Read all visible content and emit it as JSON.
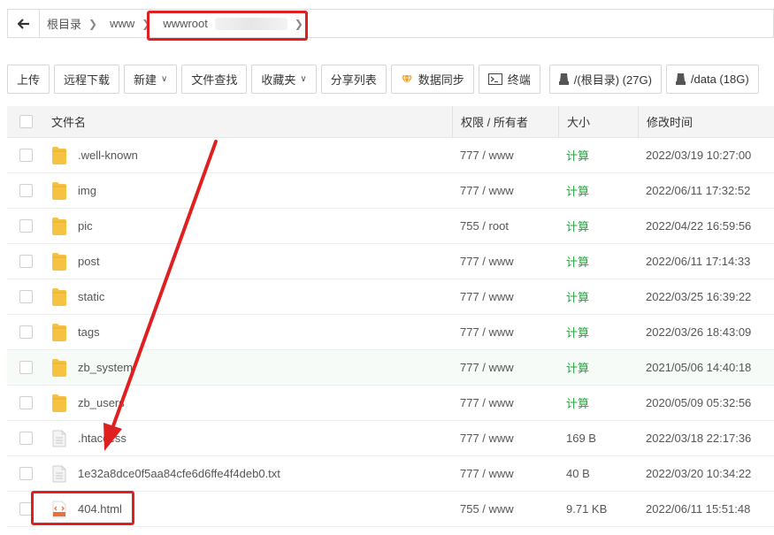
{
  "breadcrumb": {
    "items": [
      "根目录",
      "www",
      "wwwroot"
    ]
  },
  "toolbar": {
    "upload": "上传",
    "remote_download": "远程下载",
    "new": "新建",
    "file_search": "文件查找",
    "favorites": "收藏夹",
    "share_list": "分享列表",
    "data_sync": "数据同步",
    "terminal": "终端",
    "disk_root": "/(根目录) (27G)",
    "disk_data": "/data (18G)"
  },
  "table": {
    "headers": {
      "name": "文件名",
      "perm": "权限 / 所有者",
      "size": "大小",
      "mtime": "修改时间"
    },
    "rows": [
      {
        "name": ".well-known",
        "type": "folder",
        "perm": "777 / www",
        "size": "计算",
        "mtime": "2022/03/19 10:27:00"
      },
      {
        "name": "img",
        "type": "folder",
        "perm": "777 / www",
        "size": "计算",
        "mtime": "2022/06/11 17:32:52"
      },
      {
        "name": "pic",
        "type": "folder",
        "perm": "755 / root",
        "size": "计算",
        "mtime": "2022/04/22 16:59:56"
      },
      {
        "name": "post",
        "type": "folder",
        "perm": "777 / www",
        "size": "计算",
        "mtime": "2022/06/11 17:14:33"
      },
      {
        "name": "static",
        "type": "folder",
        "perm": "777 / www",
        "size": "计算",
        "mtime": "2022/03/25 16:39:22"
      },
      {
        "name": "tags",
        "type": "folder",
        "perm": "777 / www",
        "size": "计算",
        "mtime": "2022/03/26 18:43:09"
      },
      {
        "name": "zb_system",
        "type": "folder",
        "perm": "777 / www",
        "size": "计算",
        "mtime": "2021/05/06 14:40:18"
      },
      {
        "name": "zb_users",
        "type": "folder",
        "perm": "777 / www",
        "size": "计算",
        "mtime": "2020/05/09 05:32:56"
      },
      {
        "name": ".htaccess",
        "type": "file",
        "perm": "777 / www",
        "size": "169 B",
        "mtime": "2022/03/18 22:17:36"
      },
      {
        "name": "1e32a8dce0f5aa84cfe6d6ffe4f4deb0.txt",
        "type": "file",
        "perm": "777 / www",
        "size": "40 B",
        "mtime": "2022/03/20 10:34:22"
      },
      {
        "name": "404.html",
        "type": "html",
        "perm": "755 / www",
        "size": "9.71 KB",
        "mtime": "2022/06/11 15:51:48"
      }
    ]
  },
  "colors": {
    "accent_green": "#20a53a",
    "folder_yellow": "#f5c242",
    "annotation_red": "#e02020",
    "html_badge": "#e8703a"
  }
}
